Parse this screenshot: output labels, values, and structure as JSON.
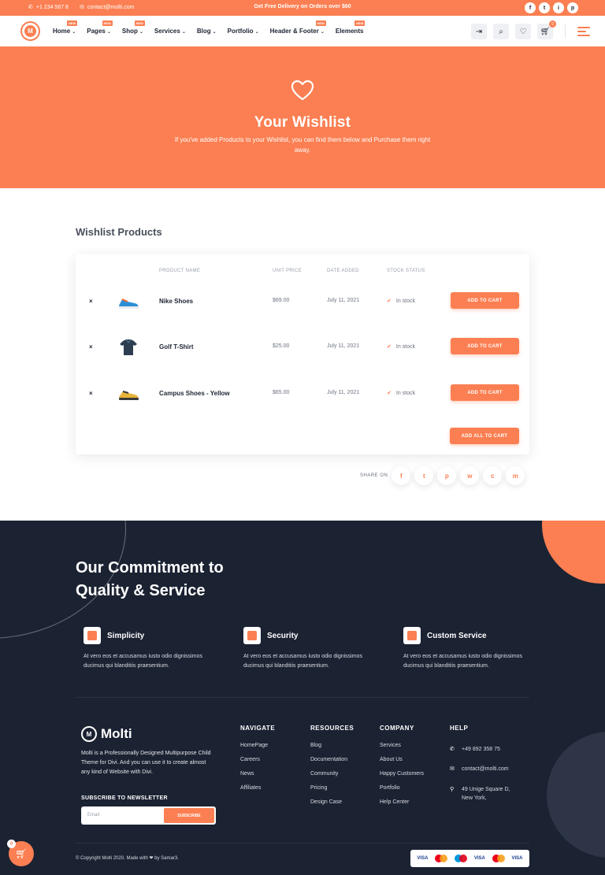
{
  "topbar": {
    "phone": "+1 234 567 8",
    "email": "contact@molti.com",
    "promo": "Get Free Delivery on Orders over $60",
    "socials": [
      "f",
      "t",
      "i",
      "p"
    ]
  },
  "header": {
    "logo_letter": "M",
    "nav": [
      {
        "label": "Home",
        "badge": "NEW"
      },
      {
        "label": "Pages",
        "badge": "NEW"
      },
      {
        "label": "Shop",
        "badge": "NEW"
      },
      {
        "label": "Services",
        "badge": ""
      },
      {
        "label": "Blog",
        "badge": ""
      },
      {
        "label": "Portfolio",
        "badge": ""
      },
      {
        "label": "Header & Footer",
        "badge": "NEW"
      },
      {
        "label": "Elements",
        "badge": "NEW"
      }
    ],
    "cart_count": "0"
  },
  "hero": {
    "title": "Your Wishlist",
    "subtitle": "If you've added Products to your Wishlist, you can find them below and Purchase them right away."
  },
  "wishlist": {
    "title": "Wishlist Products",
    "columns": {
      "product": "PRODUCT NAME",
      "price": "UNIT PRICE",
      "date": "DATE ADDED",
      "stock": "STOCK STATUS"
    },
    "rows": [
      {
        "name": "Nike Shoes",
        "price": "$69.00",
        "date": "July 11, 2021",
        "stock": "In stock",
        "button": "ADD TO CART",
        "remove": "×"
      },
      {
        "name": "Golf T-Shirt",
        "price": "$25.00",
        "date": "July 11, 2021",
        "stock": "In stock",
        "button": "ADD TO CART",
        "remove": "×"
      },
      {
        "name": "Campus Shoes - Yellow",
        "price": "$65.00",
        "date": "July 11, 2021",
        "stock": "In stock",
        "button": "ADD TO CART",
        "remove": "×"
      }
    ],
    "add_all": "ADD ALL TO CART",
    "share_label": "SHARE ON",
    "share_icons": [
      "f",
      "t",
      "p",
      "w",
      "c",
      "m"
    ]
  },
  "footer": {
    "commit_title_1": "Our Commitment to",
    "commit_title_2": "Quality & Service",
    "features": [
      {
        "title": "Simplicity",
        "desc": "At vero eos et accusamus iusto odio dignissimos ducimus qui blanditiis praesentium."
      },
      {
        "title": "Security",
        "desc": "At vero eos et accusamus iusto odio dignissimos ducimus qui blanditiis praesentium."
      },
      {
        "title": "Custom Service",
        "desc": "At vero eos et accusamus iusto odio dignissimos ducimus qui blanditiis praesentium."
      }
    ],
    "brand": "Molti",
    "about": "Molti is a Professionally Designed Multipurpose Child Theme for Divi. And you can use it to create almost any kind of Website with Divi.",
    "subscribe_title": "SUBSCRIBE TO NEWSLETTER",
    "email_placeholder": "Email",
    "subscribe_button": "SUBSCRIBE",
    "columns": [
      {
        "heading": "NAVIGATE",
        "links": [
          "HomePage",
          "Careers",
          "News",
          "Affiliates"
        ]
      },
      {
        "heading": "RESOURCES",
        "links": [
          "Blog",
          "Documentation",
          "Community",
          "Pricing",
          "Design Case"
        ]
      },
      {
        "heading": "COMPANY",
        "links": [
          "Services",
          "About Us",
          "Happy Customers",
          "Portfolio",
          "Help Center"
        ]
      }
    ],
    "help": {
      "heading": "HELP",
      "phone": "+49 892 358 75",
      "email": "contact@molti.com",
      "address": "49 Unige Square D, New York,"
    },
    "copyright": "© Copyright Molti 2020. Made with ❤ by Samar3.",
    "payments": [
      "VISA",
      "VISA",
      "VISA"
    ]
  },
  "floating_cart": {
    "count": "0"
  },
  "colors": {
    "accent": "#fb7f52",
    "dark": "#1b2232"
  }
}
